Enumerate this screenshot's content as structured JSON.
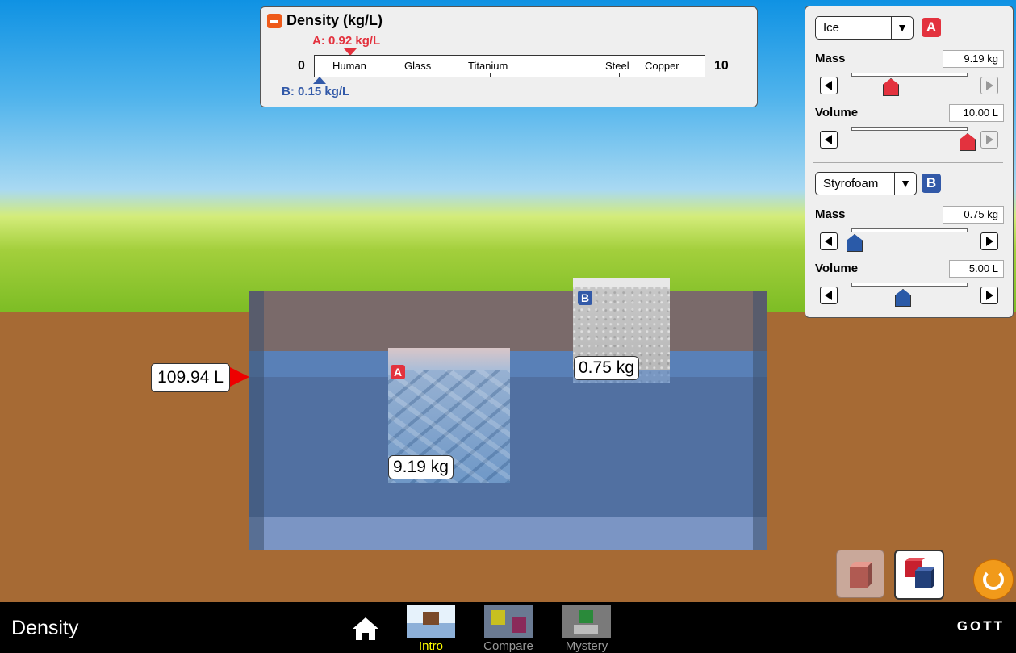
{
  "density_panel": {
    "title": "Density (kg/L)",
    "a_label": "A: 0.92 kg/L",
    "b_label": "B: 0.15 kg/L",
    "a_value": 0.92,
    "b_value": 0.15,
    "scale_min": "0",
    "scale_max": "10",
    "references": [
      "Human",
      "Glass",
      "Titanium",
      "Steel",
      "Copper"
    ]
  },
  "block_a": {
    "material": "Ice",
    "badge": "A",
    "mass_label": "Mass",
    "mass_value": "9.19 kg",
    "volume_label": "Volume",
    "volume_value": "10.00 L",
    "scene_mass": "9.19 kg",
    "color": "#e3323e"
  },
  "block_b": {
    "material": "Styrofoam",
    "badge": "B",
    "mass_label": "Mass",
    "mass_value": "0.75 kg",
    "volume_label": "Volume",
    "volume_value": "5.00 L",
    "scene_mass": "0.75 kg",
    "color": "#3259a8"
  },
  "pool": {
    "volume_readout": "109.94 L"
  },
  "nav": {
    "app_title": "Density",
    "screens": [
      "Intro",
      "Compare",
      "Mystery"
    ],
    "active_screen": "Intro",
    "brand": "GOTT"
  },
  "icons": [
    "home-icon",
    "reset-icon",
    "one-block-icon",
    "two-blocks-icon",
    "collapse-icon"
  ]
}
